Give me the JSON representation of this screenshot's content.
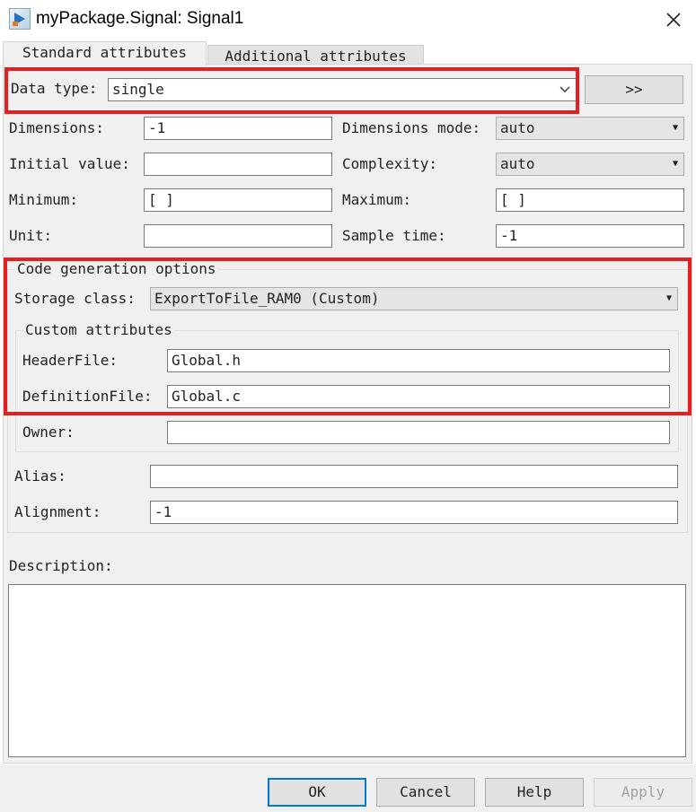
{
  "window": {
    "title": "myPackage.Signal: Signal1"
  },
  "tabs": [
    {
      "label": "Standard attributes",
      "active": true
    },
    {
      "label": "Additional attributes",
      "active": false
    }
  ],
  "fields": {
    "data_type": {
      "label": "Data type:",
      "value": "single",
      "more_button": ">>"
    },
    "dimensions": {
      "label": "Dimensions:",
      "value": "-1"
    },
    "dimensions_mode": {
      "label": "Dimensions mode:",
      "value": "auto"
    },
    "initial_value": {
      "label": "Initial value:",
      "value": ""
    },
    "complexity": {
      "label": "Complexity:",
      "value": "auto"
    },
    "minimum": {
      "label": "Minimum:",
      "value": "[ ]"
    },
    "maximum": {
      "label": "Maximum:",
      "value": "[ ]"
    },
    "unit": {
      "label": "Unit:",
      "value": ""
    },
    "sample_time": {
      "label": "Sample time:",
      "value": "-1"
    }
  },
  "code_generation": {
    "title": "Code generation options",
    "storage_class": {
      "label": "Storage class:",
      "value": "ExportToFile_RAM0 (Custom)"
    },
    "custom_attributes": {
      "title": "Custom attributes",
      "header_file": {
        "label": "HeaderFile:",
        "value": "Global.h"
      },
      "definition_file": {
        "label": "DefinitionFile:",
        "value": "Global.c"
      },
      "owner": {
        "label": "Owner:",
        "value": ""
      }
    },
    "alias": {
      "label": "Alias:",
      "value": ""
    },
    "alignment": {
      "label": "Alignment:",
      "value": "-1"
    }
  },
  "description": {
    "label": "Description:",
    "value": ""
  },
  "buttons": {
    "ok": "OK",
    "cancel": "Cancel",
    "help": "Help",
    "apply": "Apply"
  },
  "colors": {
    "highlight": "#e51f1f",
    "ok_border": "#0078d7",
    "panel": "#f0f0f0"
  }
}
